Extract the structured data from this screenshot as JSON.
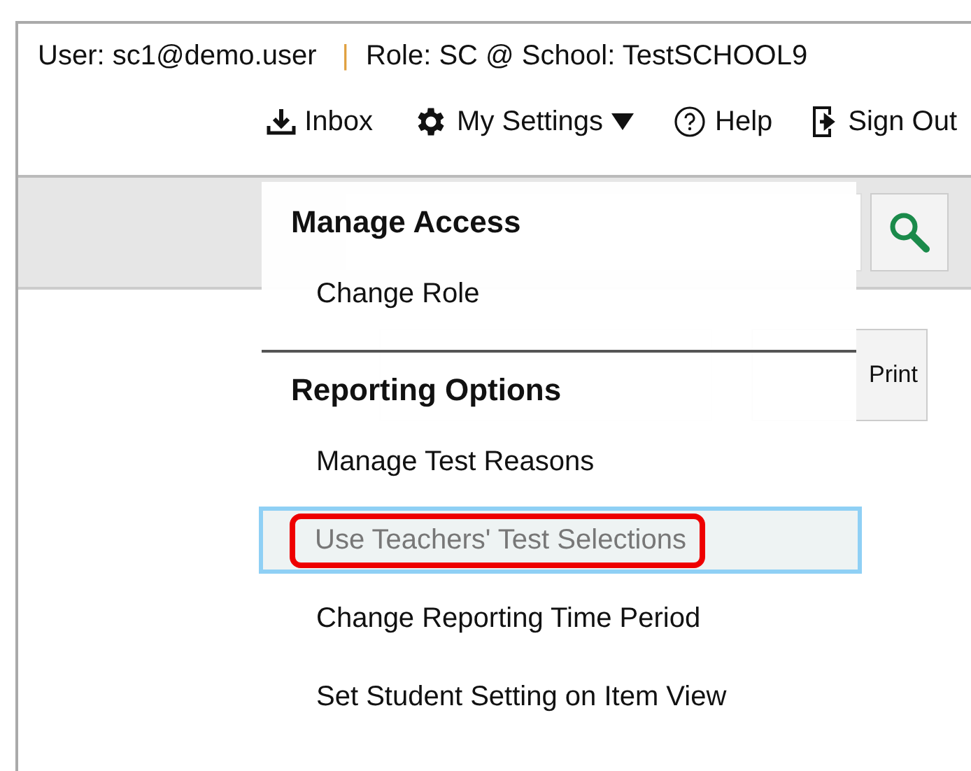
{
  "header": {
    "user": "User: sc1@demo.user",
    "separator": "|",
    "role": "Role: SC @ School: TestSCHOOL9"
  },
  "nav": [
    {
      "kind": "inbox",
      "label": "Inbox"
    },
    {
      "kind": "settings",
      "label": "My Settings"
    },
    {
      "kind": "help",
      "label": "Help"
    },
    {
      "kind": "signout",
      "label": "Sign Out"
    }
  ],
  "toolbar": {
    "print_label": "Print"
  },
  "menu": {
    "sections": [
      {
        "title": "Manage Access",
        "items": [
          {
            "label": "Change Role",
            "selected": false
          }
        ]
      },
      {
        "title": "Reporting Options",
        "items": [
          {
            "label": "Manage Test Reasons",
            "selected": false
          },
          {
            "label": "Use Teachers' Test Selections",
            "selected": true
          },
          {
            "label": "Change Reporting Time Period",
            "selected": false
          },
          {
            "label": "Set Student Setting on Item View",
            "selected": false
          }
        ]
      }
    ]
  }
}
